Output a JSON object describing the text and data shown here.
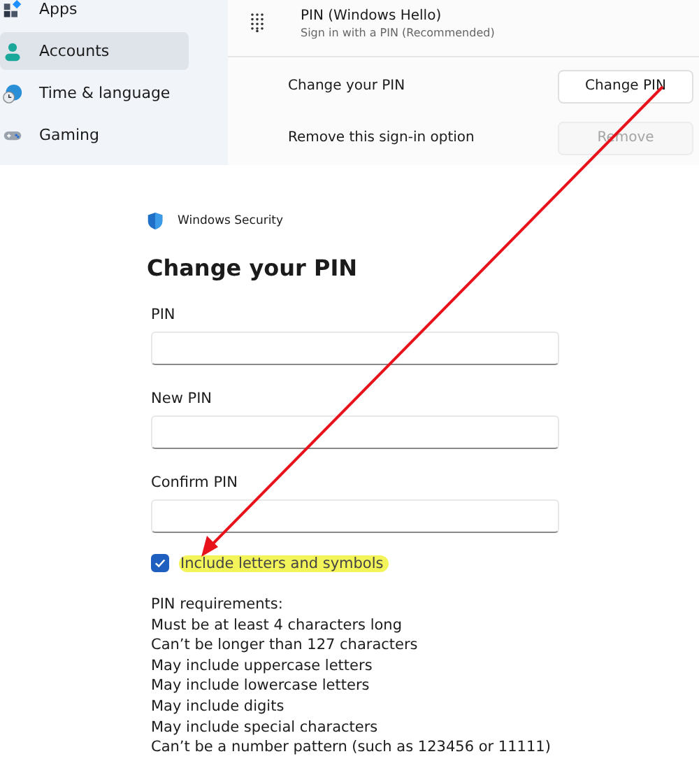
{
  "sidebar": {
    "items": [
      {
        "label": "Apps",
        "selected": false
      },
      {
        "label": "Accounts",
        "selected": true
      },
      {
        "label": "Time & language",
        "selected": false
      },
      {
        "label": "Gaming",
        "selected": false
      }
    ]
  },
  "pin_option": {
    "title": "PIN (Windows Hello)",
    "subtitle": "Sign in with a PIN (Recommended)",
    "rows": [
      {
        "label": "Change your PIN",
        "button": {
          "label": "Change PIN",
          "disabled": false
        }
      },
      {
        "label": "Remove this sign-in option",
        "button": {
          "label": "Remove",
          "disabled": true
        }
      }
    ]
  },
  "dialog": {
    "app_title": "Windows Security",
    "title": "Change your PIN",
    "fields": [
      {
        "label": "PIN"
      },
      {
        "label": "New PIN"
      },
      {
        "label": "Confirm PIN"
      }
    ],
    "checkbox": {
      "label": "Include letters and symbols",
      "checked": true
    },
    "requirements": [
      "PIN requirements:",
      "Must be at least 4 characters long",
      "Can’t be longer than 127 characters",
      "May include uppercase letters",
      "May include lowercase letters",
      "May include digits",
      "May include special characters",
      "Can’t be a number pattern (such as 123456 or 11111)"
    ]
  }
}
